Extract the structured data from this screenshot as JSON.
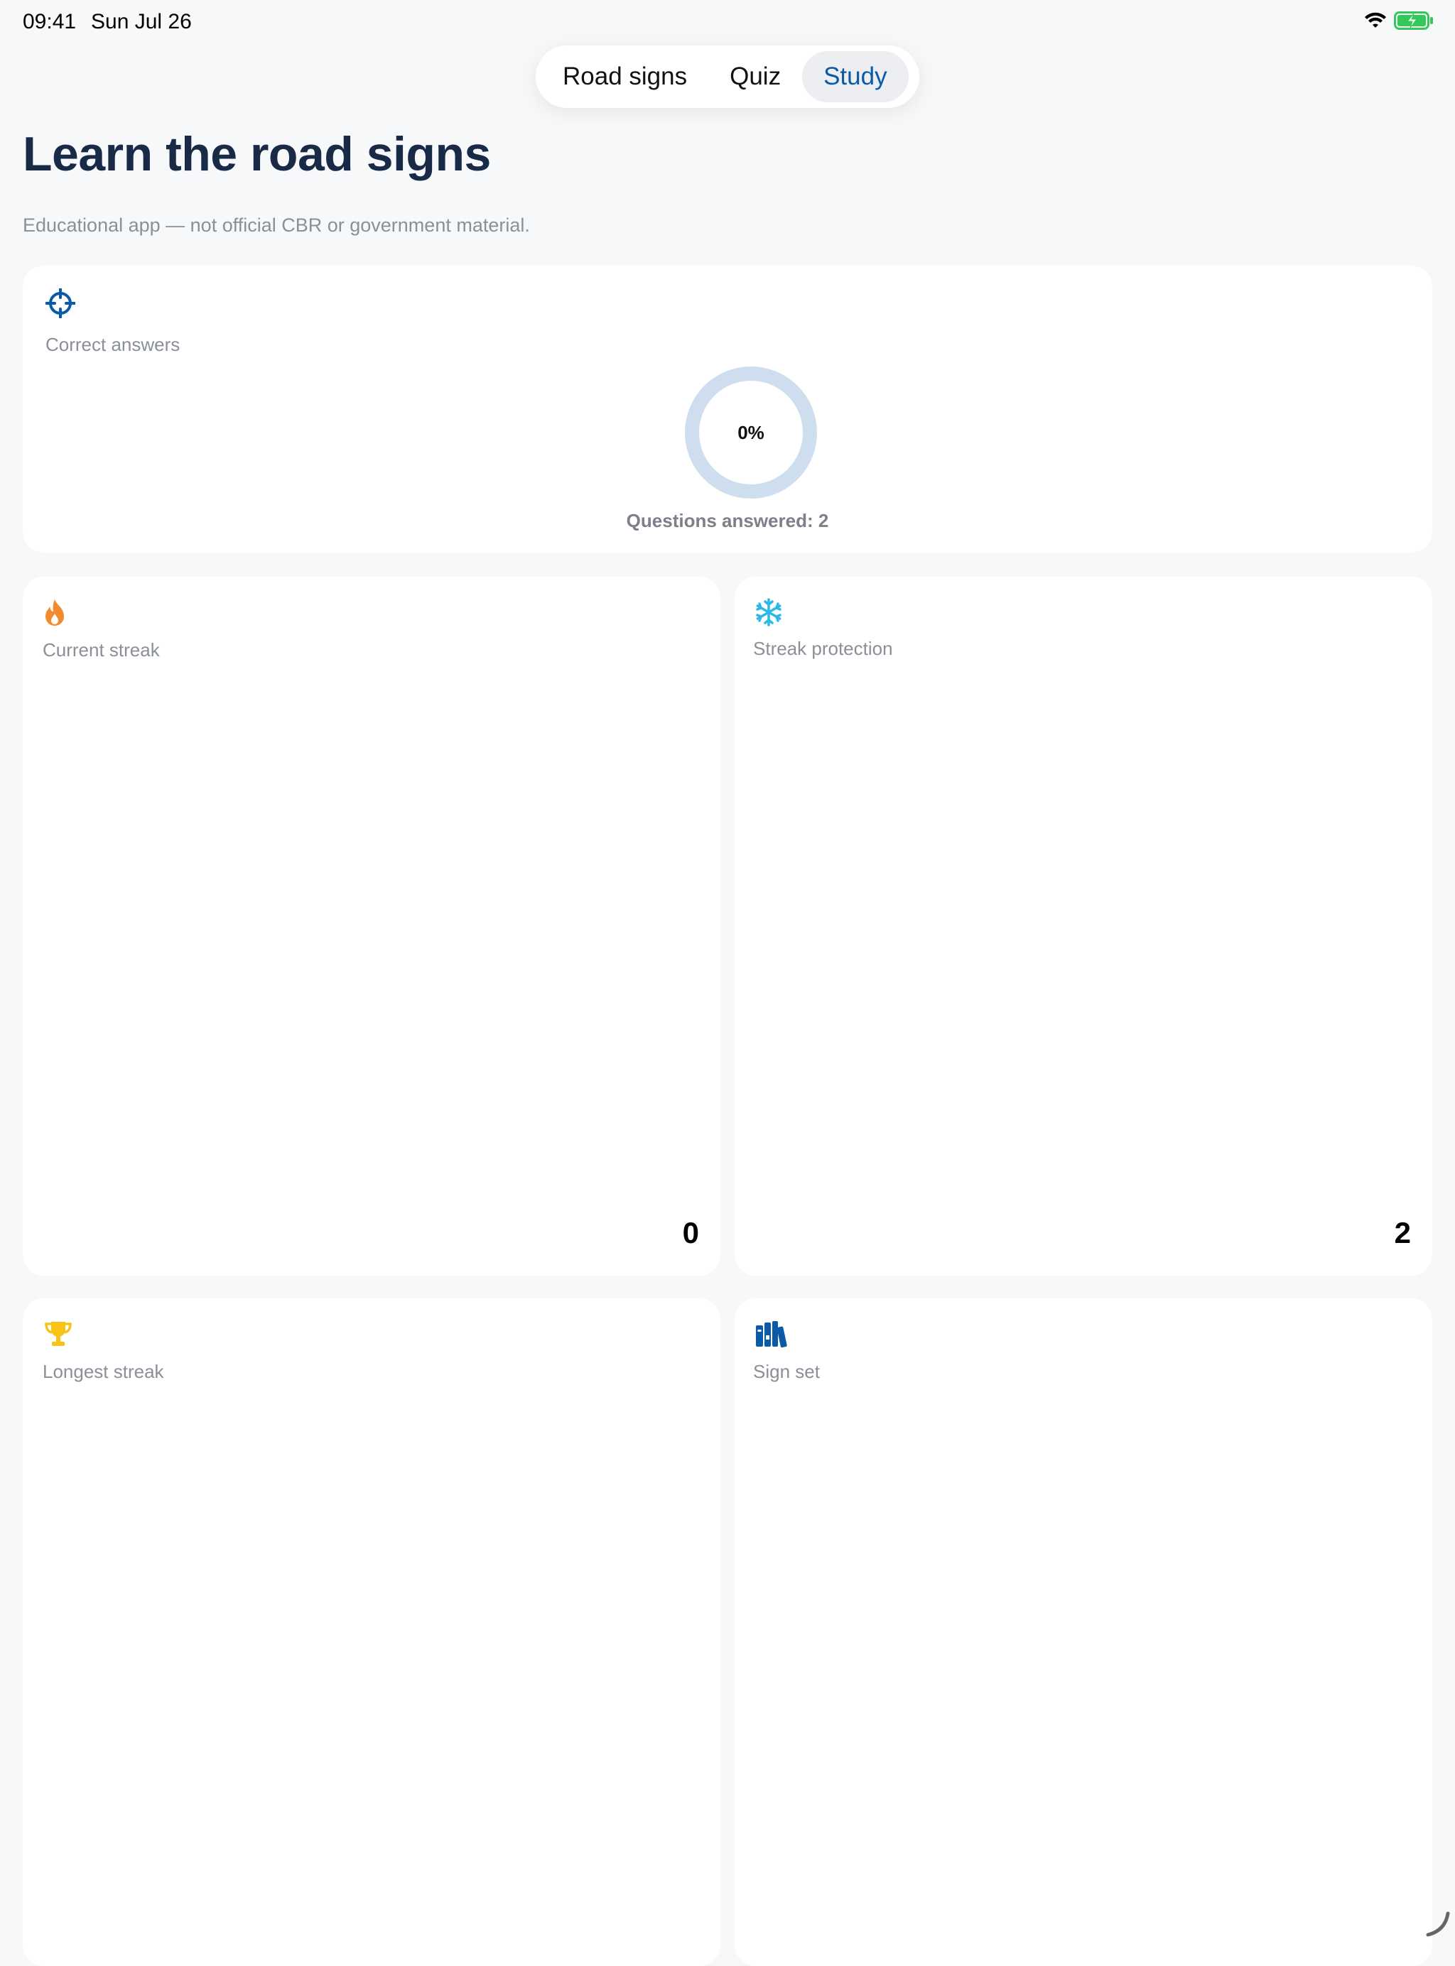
{
  "status_bar": {
    "time": "09:41",
    "date": "Sun Jul 26"
  },
  "tabs": [
    {
      "label": "Road signs",
      "active": false
    },
    {
      "label": "Quiz",
      "active": false
    },
    {
      "label": "Study",
      "active": true
    }
  ],
  "page": {
    "title": "Learn the road signs",
    "subtitle": "Educational app — not official CBR or government material."
  },
  "cards": {
    "correct": {
      "label": "Correct answers",
      "percent": "0%",
      "answered": "Questions answered: 2",
      "progress": 0,
      "icon": "crosshair-icon"
    },
    "streak": {
      "label": "Current streak",
      "value": "0",
      "icon": "flame-icon"
    },
    "protection": {
      "label": "Streak protection",
      "value": "2",
      "icon": "snowflake-icon"
    },
    "longest": {
      "label": "Longest streak",
      "icon": "trophy-icon"
    },
    "sign_set": {
      "label": "Sign set",
      "icon": "books-icon"
    }
  },
  "colors": {
    "accent": "#0a5aa8",
    "title": "#192a47",
    "ring_track": "#cfdeee",
    "flame": "#f28b30",
    "snowflake": "#2bb8e6",
    "trophy": "#f7c315",
    "battery": "#34c759"
  }
}
